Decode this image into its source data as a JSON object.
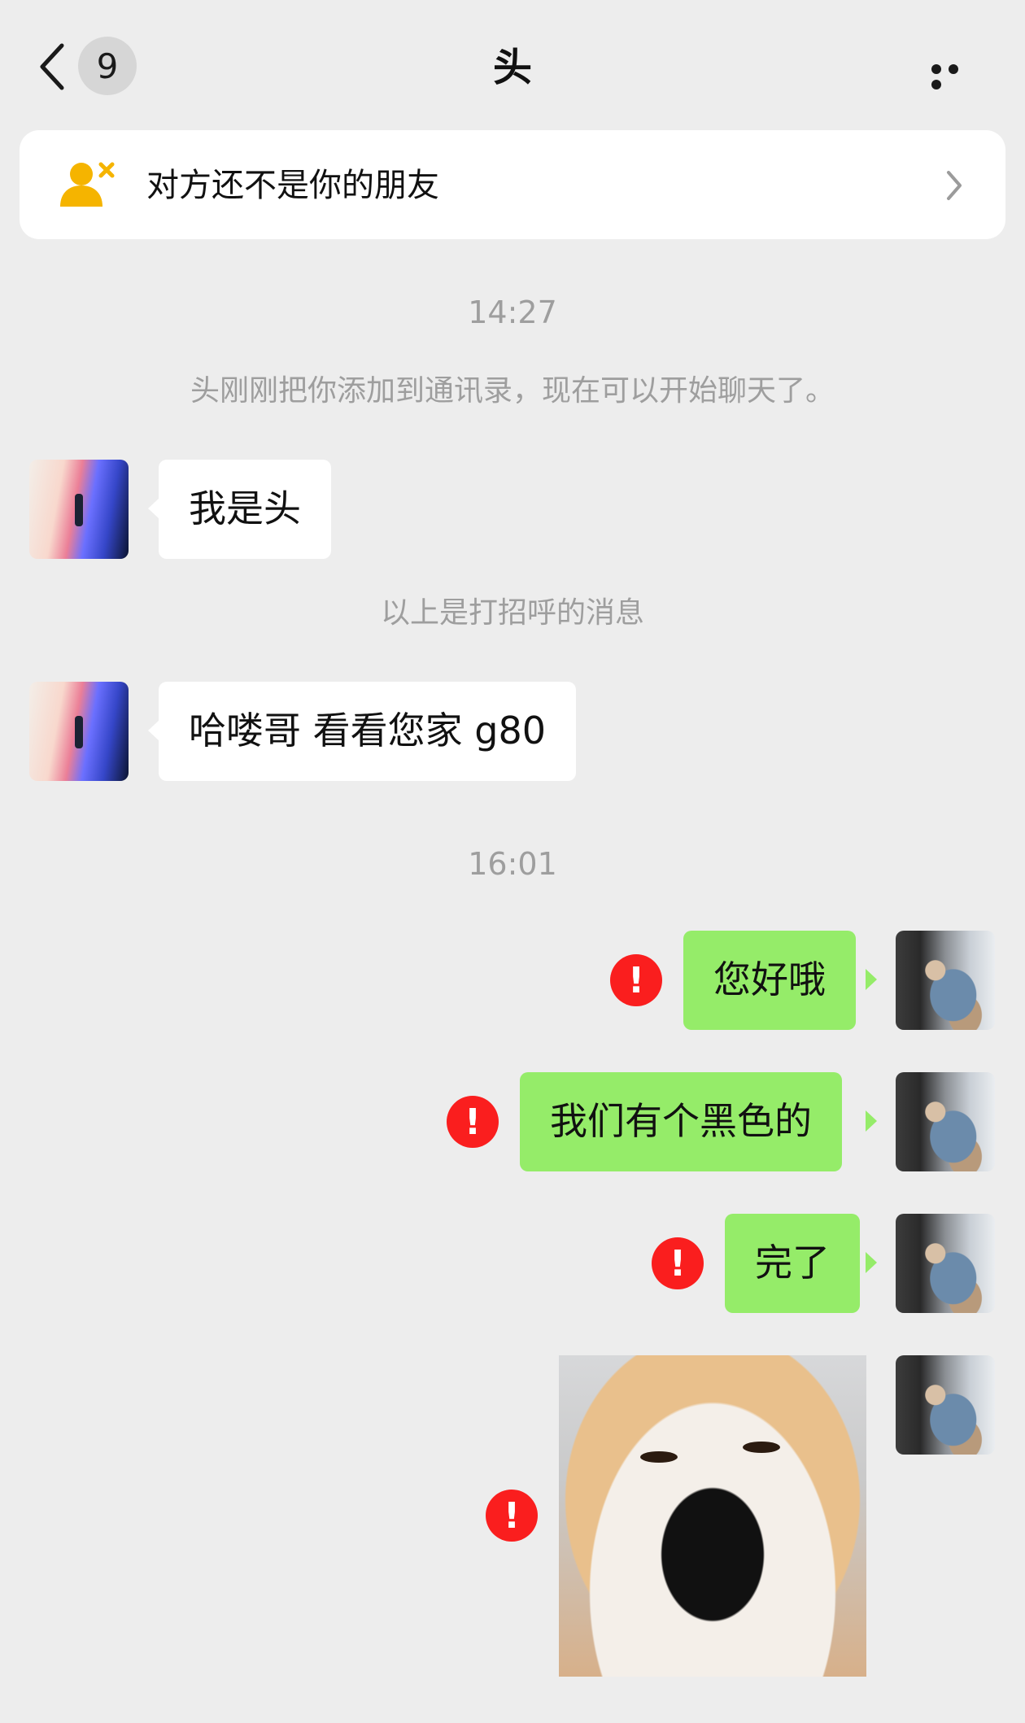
{
  "header": {
    "back_badge_count": "9",
    "title": "头"
  },
  "banner": {
    "text": "对方还不是你的朋友"
  },
  "messages": {
    "timestamp_1": "14:27",
    "system_added": "头刚刚把你添加到通讯录，现在可以开始聊天了。",
    "greeting_in": "我是头",
    "system_greeting_note": "以上是打招呼的消息",
    "msg_in_2": "哈喽哥 看看您家 g80",
    "timestamp_2": "16:01",
    "msg_out_1": "您好哦",
    "msg_out_2": "我们有个黑色的",
    "msg_out_3": "完了",
    "error_mark": "!"
  },
  "colors": {
    "background": "#ededed",
    "bubble_out": "#95ec69",
    "bubble_in": "#ffffff",
    "error_red": "#fa1e1e",
    "banner_icon": "#f5b400"
  },
  "icons": {
    "back": "chevron-left-icon",
    "more": "more-dots-icon",
    "banner": "user-remove-icon",
    "banner_arrow": "chevron-right-icon",
    "failed": "error-icon"
  }
}
